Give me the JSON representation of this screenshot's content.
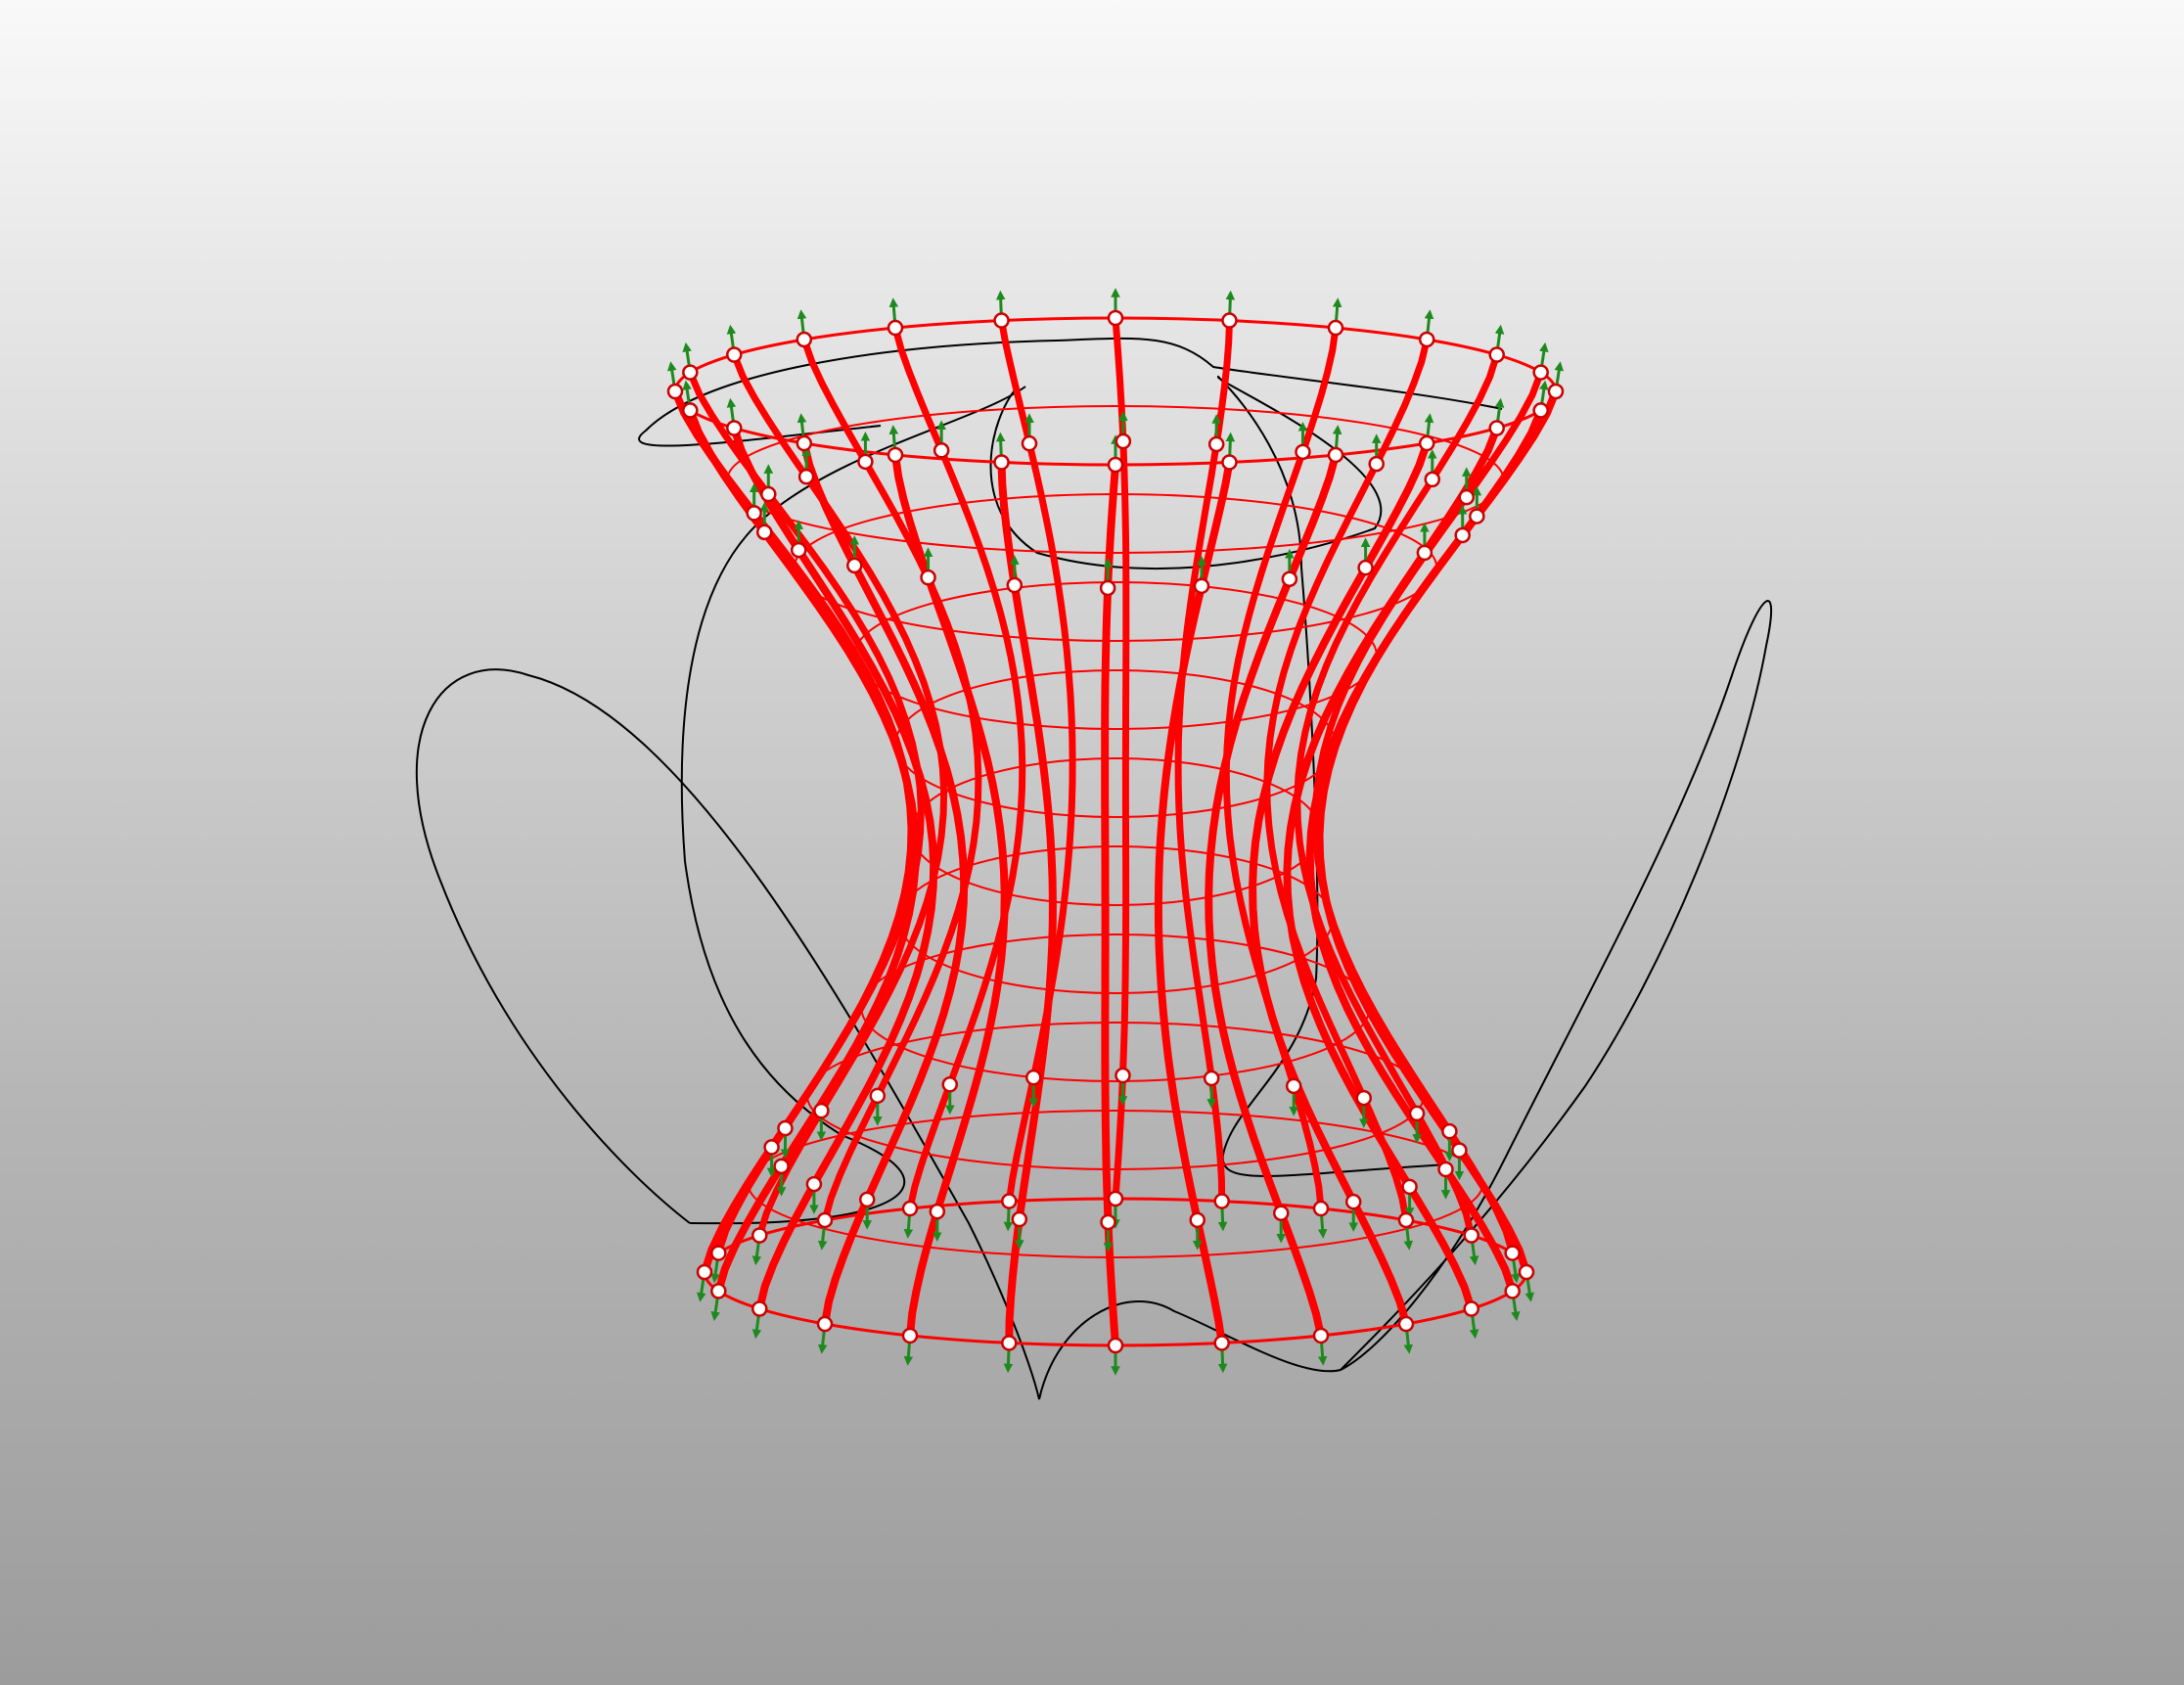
{
  "viewport": {
    "background_top": "#f9f9f9",
    "background_bottom": "#9c9c9c"
  },
  "model": {
    "type": "ruled-hyperboloid-wireframe",
    "column_count": 24,
    "ring_count": 11,
    "line_color": "#ff0000",
    "node_fill": "#ffffff",
    "node_stroke": "#cc0000",
    "arrow_color": "#1e8a1e",
    "curve_color": "#000000"
  }
}
